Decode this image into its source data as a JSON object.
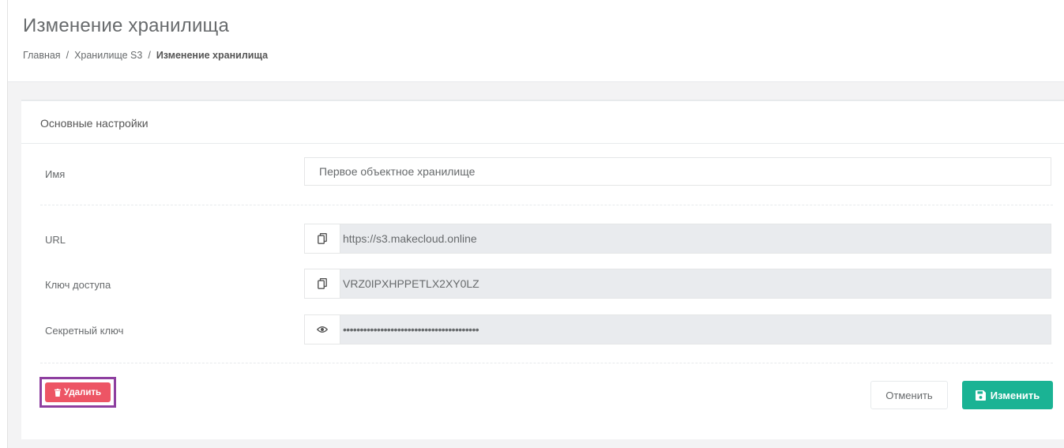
{
  "page": {
    "title": "Изменение хранилища",
    "breadcrumb": {
      "home": "Главная",
      "section": "Хранилище S3",
      "current": "Изменение хранилища",
      "separator": "/"
    }
  },
  "panel": {
    "title": "Основные настройки"
  },
  "form": {
    "name": {
      "label": "Имя",
      "value": "Первое объектное хранилище"
    },
    "url": {
      "label": "URL",
      "value": "https://s3.makecloud.online",
      "icon": "copy-icon"
    },
    "access_key": {
      "label": "Ключ доступа",
      "value": "VRZ0IPXHPPETLX2XY0LZ",
      "icon": "copy-icon"
    },
    "secret_key": {
      "label": "Секретный ключ",
      "value": "••••••••••••••••••••••••••••••••••••••••",
      "icon": "eye-icon"
    }
  },
  "actions": {
    "delete_label": "Удалить",
    "cancel_label": "Отменить",
    "save_label": "Изменить"
  },
  "colors": {
    "danger": "#ed5565",
    "primary": "#1ab394",
    "highlight": "#8e3fa0"
  }
}
